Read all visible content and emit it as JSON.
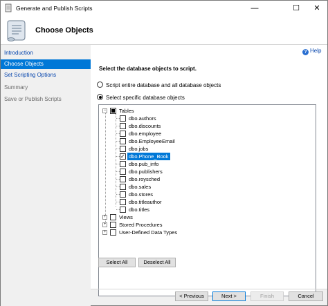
{
  "window": {
    "title": "Generate and Publish Scripts",
    "controls": {
      "minimize": "—",
      "maximize": "☐",
      "close": "✕"
    }
  },
  "header": {
    "title": "Choose Objects"
  },
  "nav": {
    "items": [
      {
        "label": "Introduction",
        "state": "link"
      },
      {
        "label": "Choose Objects",
        "state": "active"
      },
      {
        "label": "Set Scripting Options",
        "state": "link"
      },
      {
        "label": "Summary",
        "state": "disabled"
      },
      {
        "label": "Save or Publish Scripts",
        "state": "disabled"
      }
    ]
  },
  "content": {
    "help_label": "Help",
    "instruction": "Select the database objects to script.",
    "options": [
      {
        "label": "Script entire database and all database objects",
        "selected": false
      },
      {
        "label": "Select specific database objects",
        "selected": true
      }
    ]
  },
  "tree": {
    "tables_label": "Tables",
    "tables": [
      {
        "label": "dbo.authors",
        "checked": false
      },
      {
        "label": "dbo.discounts",
        "checked": false
      },
      {
        "label": "dbo.employee",
        "checked": false
      },
      {
        "label": "dbo.EmployeeEmail",
        "checked": false
      },
      {
        "label": "dbo.jobs",
        "checked": false
      },
      {
        "label": "dbo.Phone_Book",
        "checked": true
      },
      {
        "label": "dbo.pub_info",
        "checked": false
      },
      {
        "label": "dbo.publishers",
        "checked": false
      },
      {
        "label": "dbo.roysched",
        "checked": false
      },
      {
        "label": "dbo.sales",
        "checked": false
      },
      {
        "label": "dbo.stores",
        "checked": false
      },
      {
        "label": "dbo.titleauthor",
        "checked": false
      },
      {
        "label": "dbo.titles",
        "checked": false
      }
    ],
    "other_groups": [
      {
        "label": "Views"
      },
      {
        "label": "Stored Procedures"
      },
      {
        "label": "User-Defined Data Types"
      }
    ]
  },
  "buttons": {
    "select_all": "Select All",
    "deselect_all": "Deselect All",
    "previous": "< Previous",
    "next": "Next >",
    "finish": "Finish",
    "cancel": "Cancel"
  },
  "colors": {
    "accent": "#0078d7",
    "link": "#0645ad"
  }
}
